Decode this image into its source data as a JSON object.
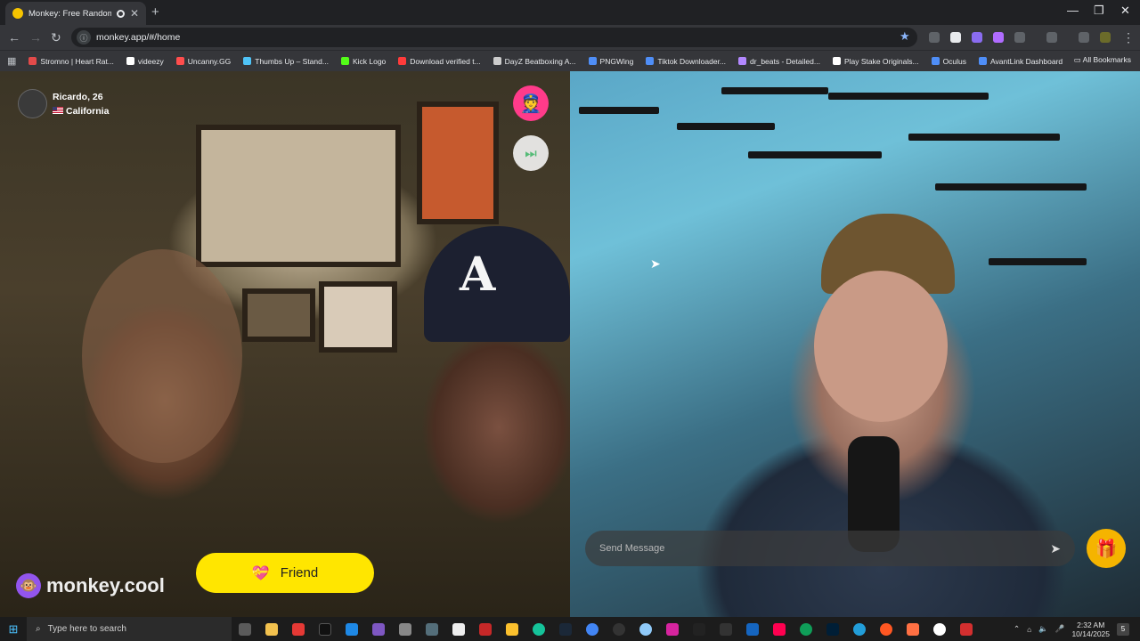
{
  "browser": {
    "tab_title": "Monkey: Free Random Vide",
    "tab_close": "✕",
    "new_tab": "+",
    "url": "monkey.app/#/home",
    "window_controls": [
      "—",
      "❐",
      "✕"
    ]
  },
  "bookmarks": [
    {
      "label": "Stromno | Heart Rat...",
      "color": "#e24a4a"
    },
    {
      "label": "videezy",
      "color": "#ffffff"
    },
    {
      "label": "Uncanny.GG",
      "color": "#ff4d4d"
    },
    {
      "label": "Thumbs Up – Stand...",
      "color": "#4fc3f7"
    },
    {
      "label": "Kick Logo",
      "color": "#53fc18"
    },
    {
      "label": "Download verified t...",
      "color": "#ff3b3b"
    },
    {
      "label": "DayZ Beatboxing A...",
      "color": "#cccccc"
    },
    {
      "label": "PNGWing",
      "color": "#4f8ef7"
    },
    {
      "label": "Tiktok Downloader...",
      "color": "#4f8ef7"
    },
    {
      "label": "dr_beats - Detailed...",
      "color": "#b388ff"
    },
    {
      "label": "Play Stake Originals...",
      "color": "#ffffff"
    },
    {
      "label": "Oculus",
      "color": "#4f8ef7"
    },
    {
      "label": "AvantLink Dashboard",
      "color": "#4f8ef7"
    }
  ],
  "all_bookmarks": "All Bookmarks",
  "remote_user": {
    "name_age": "Ricardo, 26",
    "location": "California"
  },
  "brand": "monkey.cool",
  "friend_button": "Friend",
  "message_input": {
    "placeholder": "Send Message"
  },
  "taskbar": {
    "search_placeholder": "Type here to search",
    "time": "2:32 AM",
    "date": "10/14/2025",
    "notifications": "5"
  },
  "icons": {
    "police": "police-icon",
    "skip": "skip-icon",
    "gift": "gift-icon",
    "send": "send-icon"
  }
}
